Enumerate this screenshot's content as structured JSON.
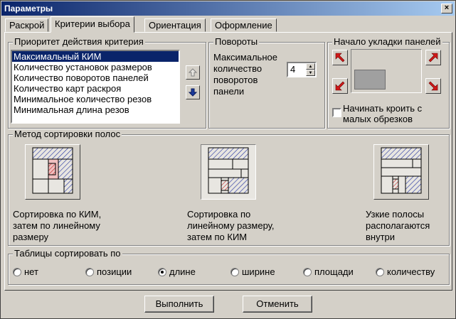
{
  "window": {
    "title": "Параметры",
    "close_label": "×"
  },
  "tabs": [
    {
      "label": "Раскрой"
    },
    {
      "label": "Критерии выбора"
    },
    {
      "label": "Ориентация"
    },
    {
      "label": "Оформление"
    }
  ],
  "priority": {
    "legend": "Приоритет действия критерия",
    "items": [
      "Максимальный КИМ",
      "Количество установок размеров",
      "Количество поворотов панелей",
      "Количество карт раскроя",
      "Минимальное количество резов",
      "Минимальная длина резов"
    ],
    "selected_index": 0
  },
  "rotations": {
    "legend": "Повороты",
    "label_lines": [
      "Максимальное",
      "количество",
      "поворотов",
      "панели"
    ],
    "value": "4"
  },
  "start": {
    "legend": "Начало укладки панелей",
    "checkbox_label_lines": [
      "Начинать кроить с",
      "малых обрезков"
    ],
    "checkbox_checked": false
  },
  "sort": {
    "legend": "Метод сортировки полос",
    "options": [
      {
        "caption_lines": [
          "Сортировка по КИМ,",
          "затем по линейному",
          "размеру"
        ]
      },
      {
        "caption_lines": [
          "Сортировка по",
          "линейному размеру,",
          "затем по КИМ"
        ]
      },
      {
        "caption_lines": [
          "Узкие полосы",
          "располагаются",
          "внутри"
        ]
      }
    ],
    "selected_index": 1
  },
  "table_sort": {
    "legend": "Таблицы сортировать по",
    "options": [
      "нет",
      "позиции",
      "длине",
      "ширине",
      "площади",
      "количеству"
    ],
    "selected_index": 2
  },
  "buttons": {
    "ok_label": "Выполнить",
    "cancel_label": "Отменить"
  },
  "colors": {
    "selection": "#0a246a",
    "titlebar": "#0a246a",
    "face": "#d4d0c8",
    "arrow_red": "#d01818",
    "arrow_blue": "#1a3a9c"
  }
}
